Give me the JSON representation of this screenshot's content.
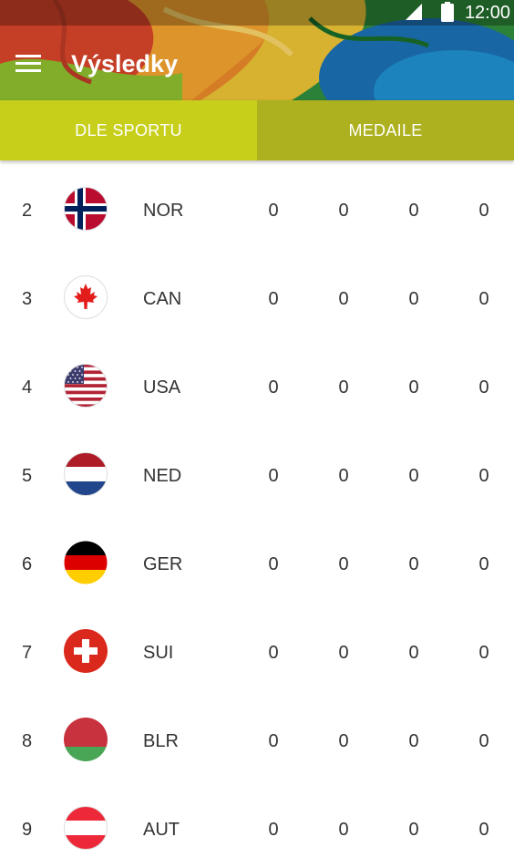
{
  "status_bar": {
    "time": "12:00"
  },
  "app_bar": {
    "title": "Výsledky",
    "menu_icon": "menu-icon"
  },
  "tabs": [
    {
      "label": "DLE SPORTU",
      "selected": true
    },
    {
      "label": "MEDAILE",
      "selected": false
    }
  ],
  "colors": {
    "tab_selected": "#c7cf1b",
    "tab_unselected": "#adb11f"
  },
  "rows": [
    {
      "rank": "2",
      "code": "NOR",
      "flag_icon": "norway-flag-icon",
      "values": [
        "0",
        "0",
        "0",
        "0"
      ]
    },
    {
      "rank": "3",
      "code": "CAN",
      "flag_icon": "canada-flag-icon",
      "values": [
        "0",
        "0",
        "0",
        "0"
      ]
    },
    {
      "rank": "4",
      "code": "USA",
      "flag_icon": "usa-flag-icon",
      "values": [
        "0",
        "0",
        "0",
        "0"
      ]
    },
    {
      "rank": "5",
      "code": "NED",
      "flag_icon": "netherlands-flag-icon",
      "values": [
        "0",
        "0",
        "0",
        "0"
      ]
    },
    {
      "rank": "6",
      "code": "GER",
      "flag_icon": "germany-flag-icon",
      "values": [
        "0",
        "0",
        "0",
        "0"
      ]
    },
    {
      "rank": "7",
      "code": "SUI",
      "flag_icon": "switzerland-flag-icon",
      "values": [
        "0",
        "0",
        "0",
        "0"
      ]
    },
    {
      "rank": "8",
      "code": "BLR",
      "flag_icon": "belarus-flag-icon",
      "values": [
        "0",
        "0",
        "0",
        "0"
      ]
    },
    {
      "rank": "9",
      "code": "AUT",
      "flag_icon": "austria-flag-icon",
      "values": [
        "0",
        "0",
        "0",
        "0"
      ]
    }
  ]
}
